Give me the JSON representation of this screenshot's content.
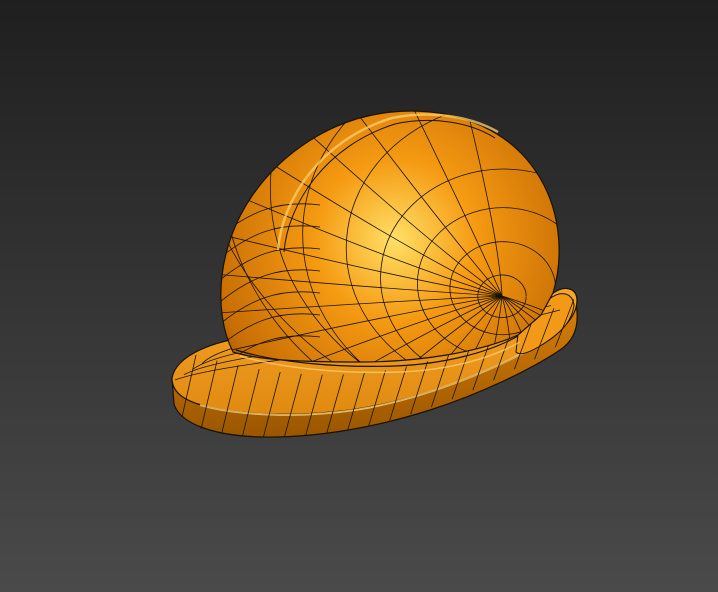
{
  "viewport": {
    "background_top": "#1f1f1f",
    "background_bottom": "#4a4a4a"
  },
  "model": {
    "object": "hard-hat",
    "shading": "smooth-with-wireframe",
    "surface_color": "#f59a12",
    "highlight_color": "#ffe066",
    "shadow_color": "#8a4a00",
    "wire_color": "#1a1200"
  }
}
